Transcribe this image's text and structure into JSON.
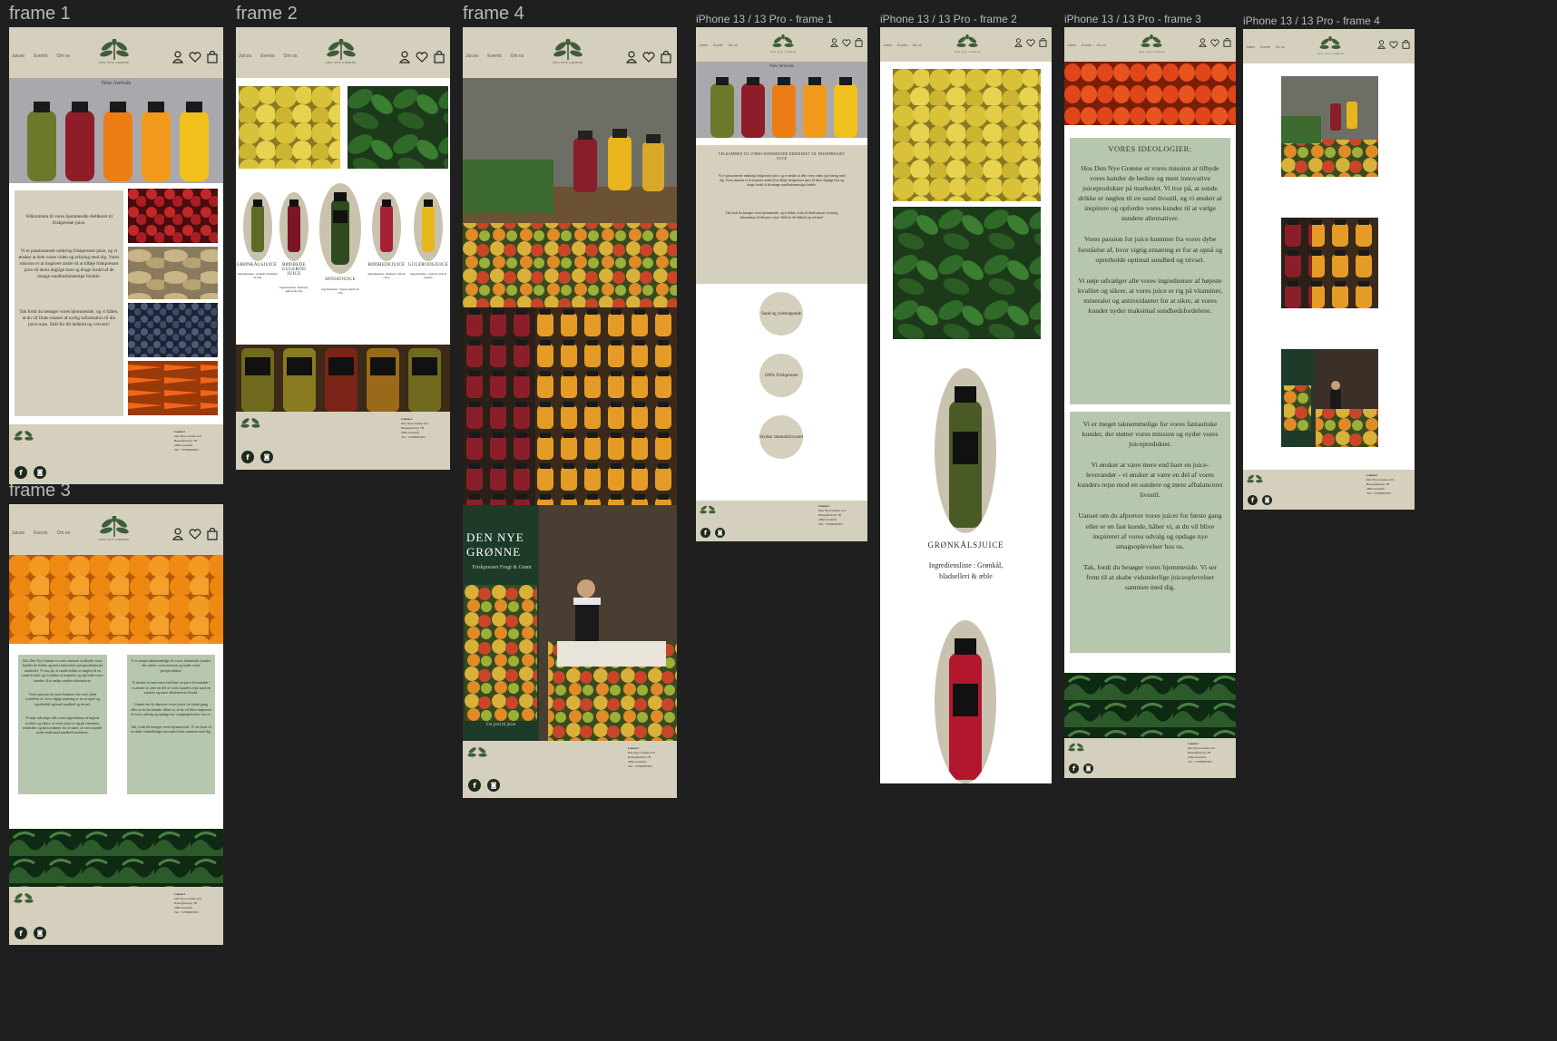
{
  "labels": {
    "f1": "frame 1",
    "f2": "frame 2",
    "f3": "frame 3",
    "f4": "frame 4",
    "m1": "iPhone 13 / 13 Pro - frame 1",
    "m2": "iPhone 13 / 13 Pro - frame 2",
    "m3": "iPhone 13 / 13 Pro - frame 3",
    "m4": "iPhone 13 / 13 Pro - frame 4"
  },
  "nav": {
    "juices": "Juices",
    "events": "Events",
    "om_os": "Om os"
  },
  "brand": "DEN NYE GRØNNE",
  "hero": {
    "new_arrivals": "New Arrivals"
  },
  "welcome": {
    "intro": "Velkommen til vores hjemmeside dedikeret til friskpresset juice.",
    "body": "Vi er passionerede omkring friskpresset juice, og vi ønsker at dele vores viden og erfaring med dig. Vores mission er at inspirere andre til at tilføje friskpresset juice til deres daglige kost og drage fordel af de mange sundhedsmæssige fordele.",
    "thanks": "Tak fordi du besøger vores hjemmeside, og vi håber, at du vil finde masser af nyttig information til din juice rejse. Skål for dit helbred og velvære!",
    "intro_caps": "VELKOMMEN TIL VORES HJEMMESIDE DEDIKERET TIL FRISKPRESSET JUICE"
  },
  "features": [
    "Sund og velsmagende",
    "100% Friskpresset",
    "Styrker immunforsvaret"
  ],
  "juices": [
    {
      "name": "GRØNKÅLSJUICE",
      "ingredients": "Ingrediensliste : Grønkål, bladselleri & æble"
    },
    {
      "name": "RØDBEDE GULEROD JUICE",
      "ingredients": "Ingrediensliste : Rødbede, gulerod & æble"
    },
    {
      "name": "SPINATJUICE",
      "ingredients": "Ingrediensliste : Spinat, ingefær & æble"
    },
    {
      "name": "RØDBEDEJUICE",
      "ingredients": "Ingrediensliste : Rødbede, æble & citron"
    },
    {
      "name": "GULERODSJUICE",
      "ingredients": "Ingrediensliste : Gulerod, æble & ingefær"
    }
  ],
  "mobile_juice": {
    "name": "GRØNKÅLSJUICE",
    "ingredients": "Ingrediensliste : Grønkål, bladselleri & æble"
  },
  "ideology": {
    "title": "VORES IDEOLOGIER:",
    "p1": "Hos Den Nye Grønne er vores mission at tilbyde vores kunder de bedste og mest innovative juiceprodukter på markedet. Vi tror på, at sunde drikke er nøglen til en sund livsstil, og vi ønsker at inspirere og opfordre vores kunder til at vælge sundere alternativer.",
    "p2": "Vores passion for juice kommer fra vores dybe forståelse af, hvor vigtig ernæring er for at opnå og opretholde optimal sundhed og trivsel.",
    "p3": "Vi nøje udvælger alle vores ingredienser af højeste kvalitet og sikrer, at vores juice er rig på vitaminer, mineraler og antioxidanter for at sikre, at vores kunder nyder maksimal sundhedsfordelene.",
    "p4": "Vi er meget taknemmelige for vores fantastiske kunder, der støtter vores mission og nyder vores juiceprodukter.",
    "p5": "Vi ønsker at være mere end bare en juice-leverandør - vi ønsker at være en del af vores kunders rejse mod en sundere og mere afbalanceret livsstil.",
    "p6": "Uanset om du afprøver vores juicer for første gang eller er en fast kunde, håber vi, at du vil blive inspireret af vores udvalg og opdage nye smagsoplevelser hos os.",
    "p7": "Tak, fordi du besøger vores hjemmeside. Vi ser frem til at skabe vidunderlige juiceoplevelser sammen med dig."
  },
  "footer": {
    "title": "Contact",
    "line1": "Den Nye Grønne A/S",
    "line2": "Bassegårdsvej 7B",
    "line3": "2820 Gentofte",
    "line4": "Tel.: +4539665363"
  },
  "booth": {
    "title": "DEN NYE GRØNNE",
    "subtitle": "Friskpresset Frugt & Grønt",
    "tagline": "Fra jord til juice"
  },
  "colors": {
    "beige": "#d5d0bd",
    "sage": "#b7c7ad",
    "leaf": "#3e5e3a",
    "canvas": "#1f1f1f"
  }
}
